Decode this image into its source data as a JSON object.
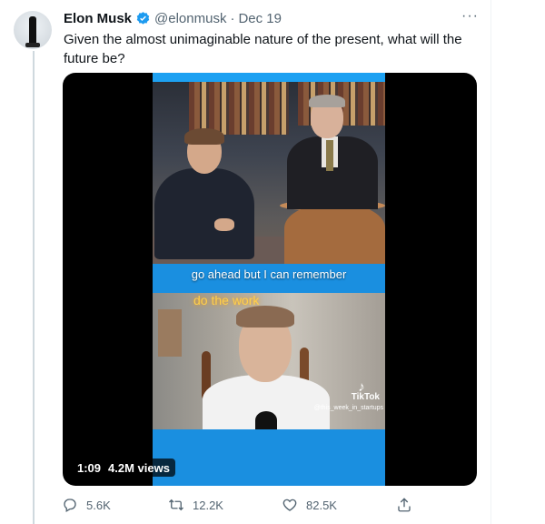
{
  "tweet": {
    "author_name": "Elon Musk",
    "handle": "@elonmusk",
    "separator": "·",
    "date": "Dec 19",
    "more_label": "···",
    "text": "Given the almost unimaginable nature of the present, what will the future be?"
  },
  "video": {
    "caption": "go ahead but I can remember",
    "neon_sign": "do the work",
    "watermark_brand": "TikTok",
    "watermark_user": "@this_week_in_startups",
    "duration": "1:09",
    "views": "4.2M views"
  },
  "actions": {
    "reply_count": "5.6K",
    "retweet_count": "12.2K",
    "like_count": "82.5K"
  },
  "icons": {
    "verified": "verified-badge-icon",
    "reply": "reply-icon",
    "retweet": "retweet-icon",
    "like": "heart-icon",
    "share": "share-icon"
  },
  "colors": {
    "verified_blue": "#1d9bf0",
    "muted_text": "#536471",
    "video_frame_blue": "#1da1f2"
  }
}
